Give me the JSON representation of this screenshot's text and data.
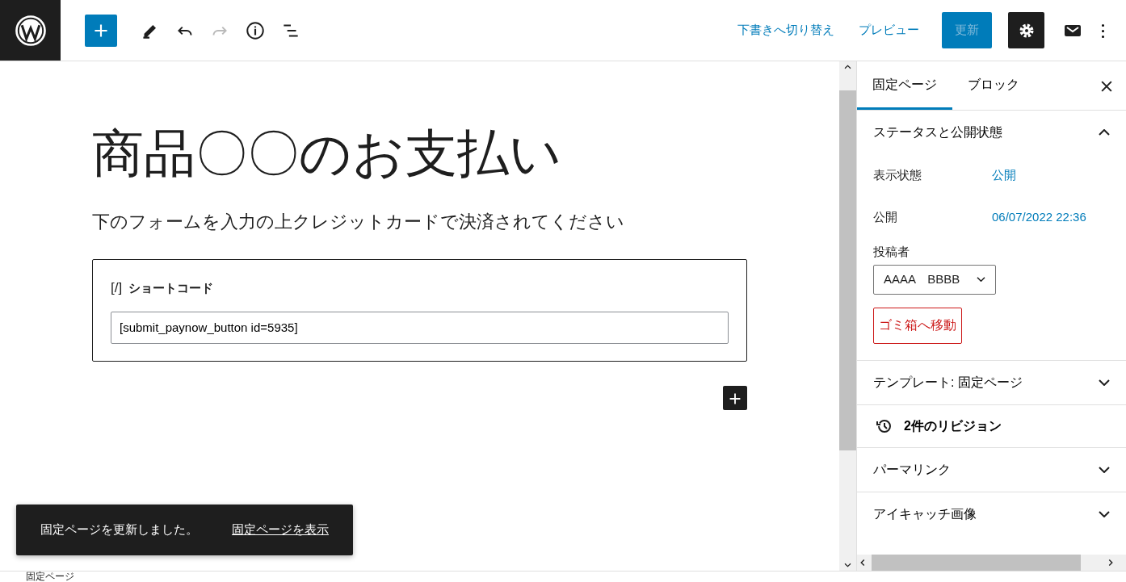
{
  "toolbar": {
    "tools": [
      {
        "kind": "inserter",
        "disabled": false
      },
      {
        "kind": "edit",
        "disabled": false
      },
      {
        "kind": "undo",
        "disabled": false
      },
      {
        "kind": "redo",
        "disabled": true
      },
      {
        "kind": "info",
        "disabled": false
      },
      {
        "kind": "outline",
        "disabled": false
      }
    ],
    "switch_to_draft": "下書きへ切り替え",
    "preview": "プレビュー",
    "update": {
      "label": "更新",
      "disabled": true
    },
    "settings_pressed": true
  },
  "editor": {
    "title": "商品〇〇のお支払い",
    "paragraph": "下のフォームを入力の上クレジットカードで決済されてください",
    "block": {
      "icon_text": "[/]",
      "label": "ショートコード",
      "value": "[submit_paynow_button id=5935]"
    }
  },
  "snackbar": {
    "message": "固定ページを更新しました。",
    "link": "固定ページを表示"
  },
  "sidebar": {
    "tabs": [
      {
        "label": "固定ページ",
        "selected": true
      },
      {
        "label": "ブロック",
        "selected": false
      }
    ],
    "panels": [
      {
        "kind": "panel",
        "title": "ステータスと公開状態",
        "expanded": true,
        "rows": [
          {
            "kind": "link",
            "label": "表示状態",
            "value": "公開"
          },
          {
            "kind": "link",
            "label": "公開",
            "value": "06/07/2022 22:36"
          },
          {
            "kind": "select",
            "label": "投稿者",
            "value": "AAAA　BBBB"
          },
          {
            "kind": "danger",
            "value": "ゴミ箱へ移動"
          }
        ]
      },
      {
        "kind": "panel",
        "title": "テンプレート: 固定ページ",
        "expanded": false
      },
      {
        "kind": "revisions",
        "title": "2件のリビジョン"
      },
      {
        "kind": "panel",
        "title": "パーマリンク",
        "expanded": false
      },
      {
        "kind": "panel",
        "title": "アイキャッチ画像",
        "expanded": false
      }
    ]
  },
  "footer": {
    "breadcrumb": "固定ページ"
  }
}
